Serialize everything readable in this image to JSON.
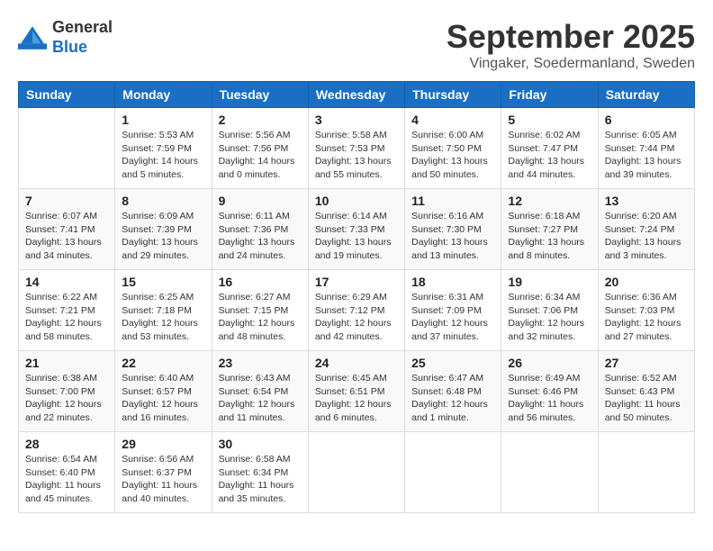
{
  "header": {
    "logo_line1": "General",
    "logo_line2": "Blue",
    "title": "September 2025",
    "subtitle": "Vingaker, Soedermanland, Sweden"
  },
  "days_of_week": [
    "Sunday",
    "Monday",
    "Tuesday",
    "Wednesday",
    "Thursday",
    "Friday",
    "Saturday"
  ],
  "weeks": [
    [
      {
        "day": "",
        "detail": ""
      },
      {
        "day": "1",
        "detail": "Sunrise: 5:53 AM\nSunset: 7:59 PM\nDaylight: 14 hours\nand 5 minutes."
      },
      {
        "day": "2",
        "detail": "Sunrise: 5:56 AM\nSunset: 7:56 PM\nDaylight: 14 hours\nand 0 minutes."
      },
      {
        "day": "3",
        "detail": "Sunrise: 5:58 AM\nSunset: 7:53 PM\nDaylight: 13 hours\nand 55 minutes."
      },
      {
        "day": "4",
        "detail": "Sunrise: 6:00 AM\nSunset: 7:50 PM\nDaylight: 13 hours\nand 50 minutes."
      },
      {
        "day": "5",
        "detail": "Sunrise: 6:02 AM\nSunset: 7:47 PM\nDaylight: 13 hours\nand 44 minutes."
      },
      {
        "day": "6",
        "detail": "Sunrise: 6:05 AM\nSunset: 7:44 PM\nDaylight: 13 hours\nand 39 minutes."
      }
    ],
    [
      {
        "day": "7",
        "detail": "Sunrise: 6:07 AM\nSunset: 7:41 PM\nDaylight: 13 hours\nand 34 minutes."
      },
      {
        "day": "8",
        "detail": "Sunrise: 6:09 AM\nSunset: 7:39 PM\nDaylight: 13 hours\nand 29 minutes."
      },
      {
        "day": "9",
        "detail": "Sunrise: 6:11 AM\nSunset: 7:36 PM\nDaylight: 13 hours\nand 24 minutes."
      },
      {
        "day": "10",
        "detail": "Sunrise: 6:14 AM\nSunset: 7:33 PM\nDaylight: 13 hours\nand 19 minutes."
      },
      {
        "day": "11",
        "detail": "Sunrise: 6:16 AM\nSunset: 7:30 PM\nDaylight: 13 hours\nand 13 minutes."
      },
      {
        "day": "12",
        "detail": "Sunrise: 6:18 AM\nSunset: 7:27 PM\nDaylight: 13 hours\nand 8 minutes."
      },
      {
        "day": "13",
        "detail": "Sunrise: 6:20 AM\nSunset: 7:24 PM\nDaylight: 13 hours\nand 3 minutes."
      }
    ],
    [
      {
        "day": "14",
        "detail": "Sunrise: 6:22 AM\nSunset: 7:21 PM\nDaylight: 12 hours\nand 58 minutes."
      },
      {
        "day": "15",
        "detail": "Sunrise: 6:25 AM\nSunset: 7:18 PM\nDaylight: 12 hours\nand 53 minutes."
      },
      {
        "day": "16",
        "detail": "Sunrise: 6:27 AM\nSunset: 7:15 PM\nDaylight: 12 hours\nand 48 minutes."
      },
      {
        "day": "17",
        "detail": "Sunrise: 6:29 AM\nSunset: 7:12 PM\nDaylight: 12 hours\nand 42 minutes."
      },
      {
        "day": "18",
        "detail": "Sunrise: 6:31 AM\nSunset: 7:09 PM\nDaylight: 12 hours\nand 37 minutes."
      },
      {
        "day": "19",
        "detail": "Sunrise: 6:34 AM\nSunset: 7:06 PM\nDaylight: 12 hours\nand 32 minutes."
      },
      {
        "day": "20",
        "detail": "Sunrise: 6:36 AM\nSunset: 7:03 PM\nDaylight: 12 hours\nand 27 minutes."
      }
    ],
    [
      {
        "day": "21",
        "detail": "Sunrise: 6:38 AM\nSunset: 7:00 PM\nDaylight: 12 hours\nand 22 minutes."
      },
      {
        "day": "22",
        "detail": "Sunrise: 6:40 AM\nSunset: 6:57 PM\nDaylight: 12 hours\nand 16 minutes."
      },
      {
        "day": "23",
        "detail": "Sunrise: 6:43 AM\nSunset: 6:54 PM\nDaylight: 12 hours\nand 11 minutes."
      },
      {
        "day": "24",
        "detail": "Sunrise: 6:45 AM\nSunset: 6:51 PM\nDaylight: 12 hours\nand 6 minutes."
      },
      {
        "day": "25",
        "detail": "Sunrise: 6:47 AM\nSunset: 6:48 PM\nDaylight: 12 hours\nand 1 minute."
      },
      {
        "day": "26",
        "detail": "Sunrise: 6:49 AM\nSunset: 6:46 PM\nDaylight: 11 hours\nand 56 minutes."
      },
      {
        "day": "27",
        "detail": "Sunrise: 6:52 AM\nSunset: 6:43 PM\nDaylight: 11 hours\nand 50 minutes."
      }
    ],
    [
      {
        "day": "28",
        "detail": "Sunrise: 6:54 AM\nSunset: 6:40 PM\nDaylight: 11 hours\nand 45 minutes."
      },
      {
        "day": "29",
        "detail": "Sunrise: 6:56 AM\nSunset: 6:37 PM\nDaylight: 11 hours\nand 40 minutes."
      },
      {
        "day": "30",
        "detail": "Sunrise: 6:58 AM\nSunset: 6:34 PM\nDaylight: 11 hours\nand 35 minutes."
      },
      {
        "day": "",
        "detail": ""
      },
      {
        "day": "",
        "detail": ""
      },
      {
        "day": "",
        "detail": ""
      },
      {
        "day": "",
        "detail": ""
      }
    ]
  ]
}
